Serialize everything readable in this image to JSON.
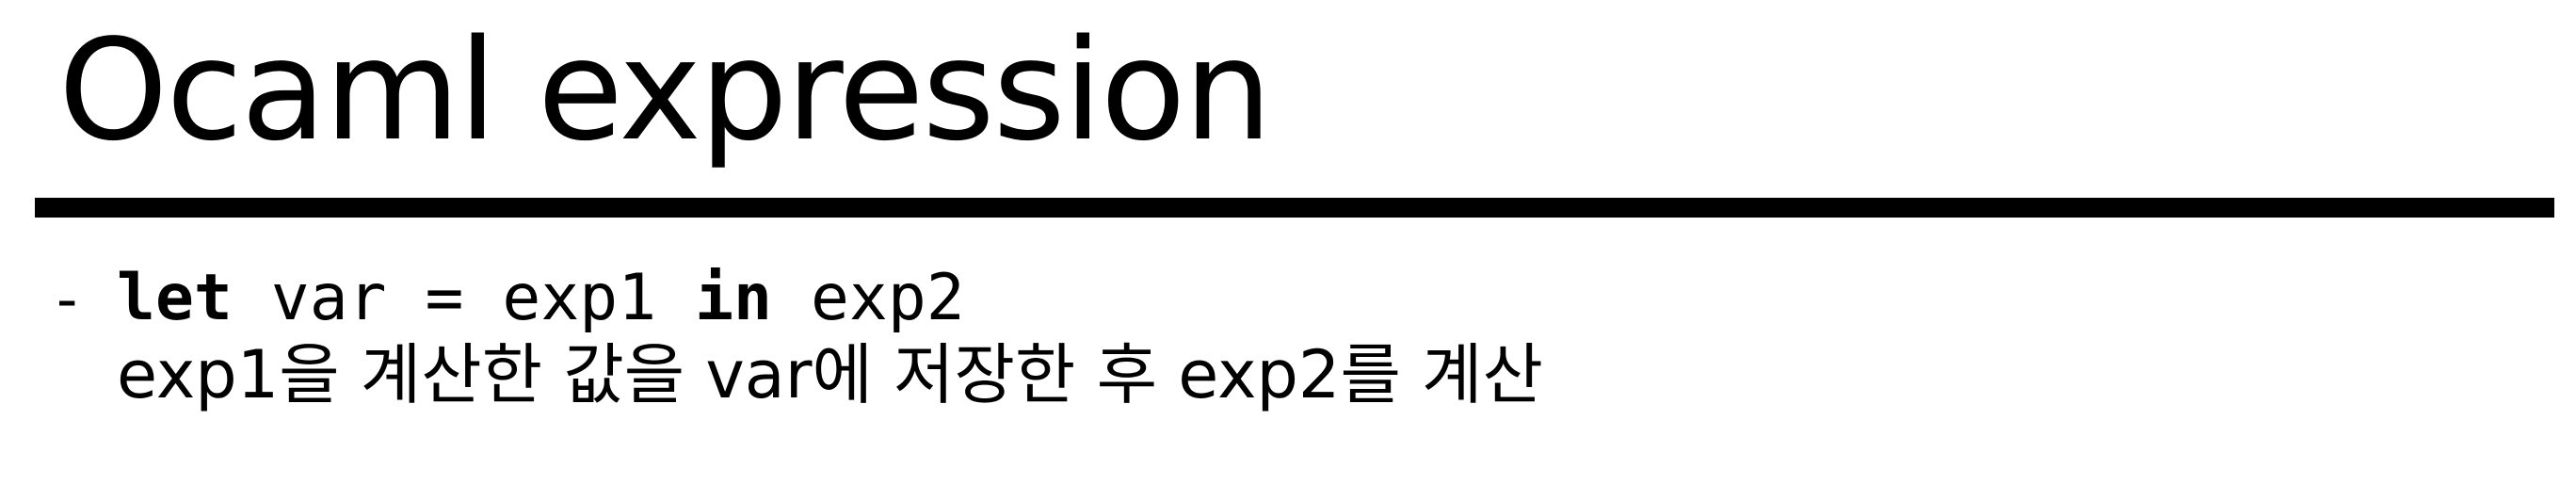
{
  "slide": {
    "title": "Ocaml expression",
    "bullet": {
      "marker": "-",
      "code": {
        "kw_let": "let",
        "part1": " var = exp1 ",
        "kw_in": "in",
        "part2": " exp2"
      },
      "description": "exp1을 계산한 값을 var에 저장한 후 exp2를 계산"
    }
  }
}
